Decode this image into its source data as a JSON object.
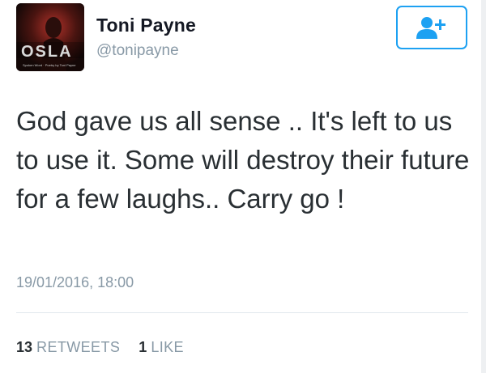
{
  "user": {
    "name": "Toni Payne",
    "handle": "@tonipayne",
    "avatar": {
      "title_text": "OSLA",
      "caption_text": "Spoken Word · Poetry by Toni Payne"
    }
  },
  "follow_button": {
    "icon": "add-user-icon",
    "color": "#1da1f2"
  },
  "tweet": {
    "text": "God gave us all sense .. It's left to us to use it. Some will destroy their future for a few laughs.. Carry go !",
    "timestamp": "19/01/2016, 18:00"
  },
  "stats": {
    "retweets_count": "13",
    "retweets_label": "RETWEETS",
    "likes_count": "1",
    "likes_label": "LIKE"
  },
  "colors": {
    "accent": "#1da1f2",
    "muted": "#8899a6",
    "text": "#292f33"
  }
}
